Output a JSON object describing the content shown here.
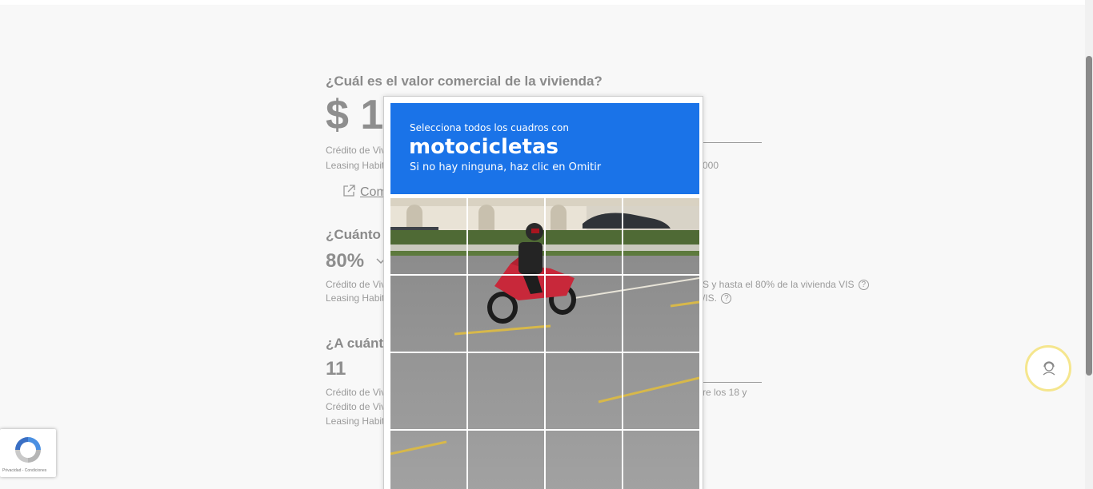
{
  "form": {
    "q1": "¿Cuál es el valor comercial de la vivienda?",
    "q1_value": "$ 1",
    "q1_note1": "Crédito de Viv",
    "q1_note2": "Leasing Habit",
    "q1_note2_right": "000",
    "link": "Com",
    "q2": "¿Cuánto d",
    "q2_value": "80%",
    "q2_note1": "Crédito de Viv",
    "q2_note1_right": "S y hasta el 80% de la vivienda VIS",
    "q2_note2": "Leasing Habit",
    "q2_note2_right": "/IS.",
    "q3": "¿A cuánto",
    "q3_value": "11",
    "q3_note1": "Crédito de Viv",
    "q3_note1_right": "re los 18 y",
    "q3_note2": "Crédito de Viv",
    "q3_note3": "Leasing Habit",
    "help": "?"
  },
  "captcha": {
    "instruction": "Selecciona todos los cuadros con",
    "target": "motocicletas",
    "hint": "Si no hay ninguna, haz clic en Omitir"
  },
  "badge": {
    "text": "Privacidad - Condiciones"
  },
  "icons": {
    "external": "external-link-icon",
    "dropdown": "chevron-down-icon",
    "support": "support-agent-icon",
    "recaptcha": "recaptcha-logo-icon"
  },
  "colors": {
    "captcha_header": "#1a73e8",
    "support_ring": "#f5e68e"
  }
}
